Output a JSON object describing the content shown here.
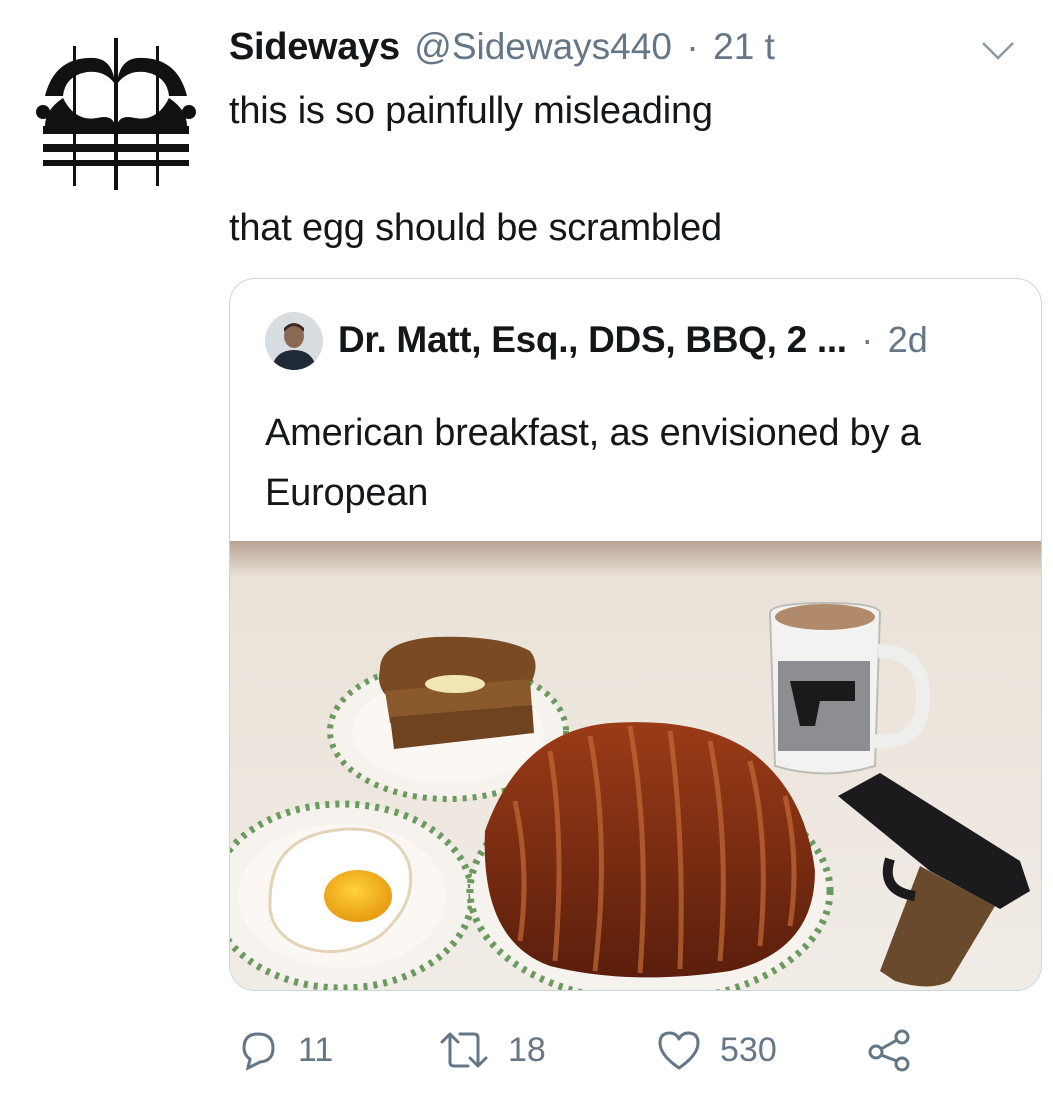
{
  "tweet": {
    "display_name": "Sideways",
    "handle": "@Sideways440",
    "separator": "·",
    "time": "21 t",
    "text_line1": "this is so painfully misleading",
    "text_line2": "that egg should be scrambled",
    "avatar_icon": "stylized-logo-icon",
    "menu_icon": "chevron-down-icon"
  },
  "quoted": {
    "display_name": "Dr. Matt, Esq., DDS, BBQ, 2 ...",
    "separator": "·",
    "time": "2d",
    "text": "American breakfast, as envisioned by a European",
    "image_icon": "breakfast-photo"
  },
  "actions": {
    "reply_count": "11",
    "retweet_count": "18",
    "like_count": "530",
    "reply_icon": "reply-icon",
    "retweet_icon": "retweet-icon",
    "like_icon": "heart-icon",
    "share_icon": "share-icon"
  },
  "colors": {
    "text": "#14171a",
    "secondary": "#657786",
    "border": "#ccd6dd"
  }
}
